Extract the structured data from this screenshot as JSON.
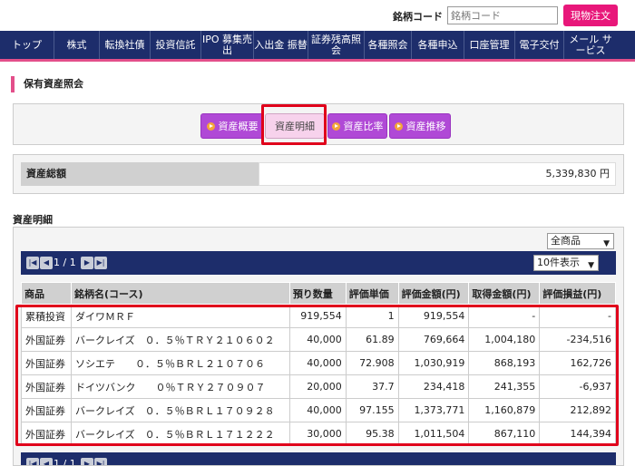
{
  "header": {
    "code_label": "銘柄コード",
    "code_placeholder": "銘柄コード",
    "genbutsu_label": "現物注文"
  },
  "nav": [
    {
      "label": "トップ"
    },
    {
      "label": "株式"
    },
    {
      "label": "転換社債"
    },
    {
      "label": "投資信託"
    },
    {
      "label": "IPO 募集売出"
    },
    {
      "label": "入出金 振替"
    },
    {
      "label": "証券残高照会"
    },
    {
      "label": "各種照会"
    },
    {
      "label": "各種申込"
    },
    {
      "label": "口座管理"
    },
    {
      "label": "電子交付"
    },
    {
      "label": "メール サービス"
    }
  ],
  "page_title": "保有資産照会",
  "tabs": [
    {
      "label": "資産概要",
      "active": false
    },
    {
      "label": "資産明細",
      "active": true
    },
    {
      "label": "資産比率",
      "active": false
    },
    {
      "label": "資産推移",
      "active": false
    }
  ],
  "total": {
    "label": "資産総額",
    "value": "5,339,830 円"
  },
  "details": {
    "section_title": "資産明細",
    "filter_value": "全商品",
    "page_text": "1 / 1",
    "per_page_value": "10件表示",
    "columns": [
      "商品",
      "銘柄名(コース)",
      "預り数量",
      "評価単価",
      "評価金額(円)",
      "取得金額(円)",
      "評価損益(円)"
    ],
    "rows": [
      [
        "累積投資",
        "ダイワＭＲＦ",
        "919,554",
        "1",
        "919,554",
        "-",
        "-"
      ],
      [
        "外国証券",
        "バークレイズ　０．５％ＴＲＹ２１０６０２",
        "40,000",
        "61.89",
        "769,664",
        "1,004,180",
        "-234,516"
      ],
      [
        "外国証券",
        "ソシエテ　　０．５％ＢＲＬ２１０７０６",
        "40,000",
        "72.908",
        "1,030,919",
        "868,193",
        "162,726"
      ],
      [
        "外国証券",
        "ドイツバンク　　０％ＴＲＹ２７０９０７",
        "20,000",
        "37.7",
        "234,418",
        "241,355",
        "-6,937"
      ],
      [
        "外国証券",
        "バークレイズ　０．５％ＢＲＬ１７０９２８",
        "40,000",
        "97.155",
        "1,373,771",
        "1,160,879",
        "212,892"
      ],
      [
        "外国証券",
        "バークレイズ　０．５％ＢＲＬ１７１２２２",
        "30,000",
        "95.38",
        "1,011,504",
        "867,110",
        "144,394"
      ]
    ]
  },
  "colors": {
    "nav_bg": "#1d2d6b",
    "accent_pink": "#e8177a",
    "tab_purple": "#b049d6",
    "highlight_red": "#e0001b"
  }
}
